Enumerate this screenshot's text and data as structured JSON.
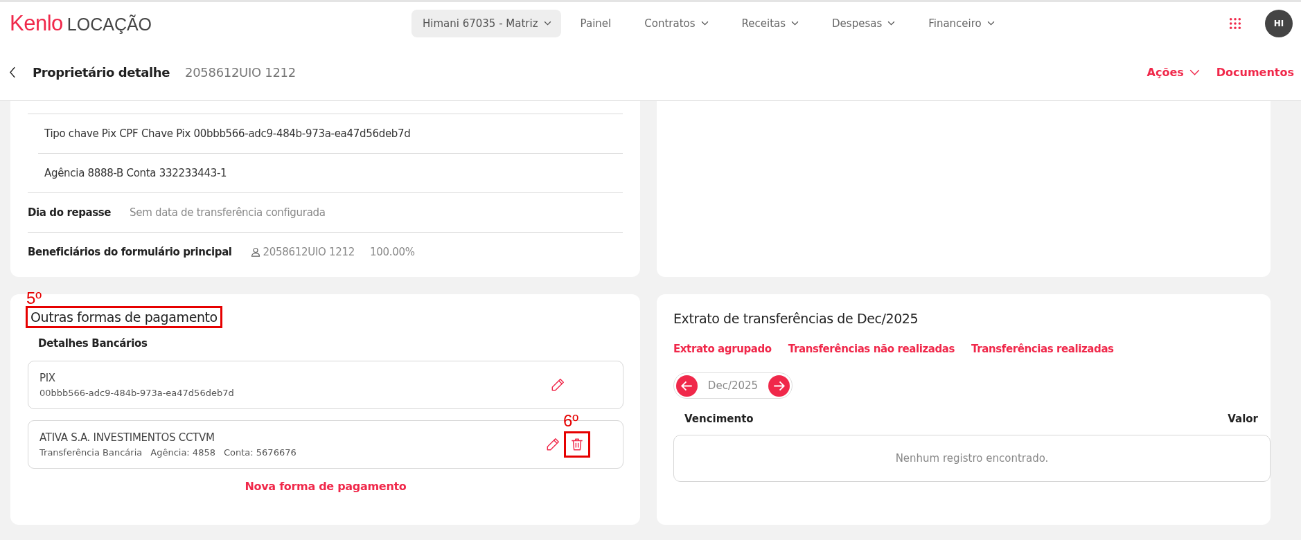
{
  "app": {
    "logo_brand": "Kenlo",
    "logo_product": "LOCAÇÃO"
  },
  "nav": {
    "branch": "Himani 67035 - Matriz",
    "items": [
      {
        "label": "Painel",
        "dropdown": false
      },
      {
        "label": "Contratos",
        "dropdown": true
      },
      {
        "label": "Receitas",
        "dropdown": true
      },
      {
        "label": "Despesas",
        "dropdown": true
      },
      {
        "label": "Financeiro",
        "dropdown": true
      }
    ],
    "avatar": "HI"
  },
  "page": {
    "title": "Proprietário detalhe",
    "code": "2058612UIO 1212",
    "actions": [
      {
        "label": "Ações",
        "dropdown": true
      },
      {
        "label": "Documentos",
        "dropdown": false
      }
    ]
  },
  "owner_details": {
    "bank_rows": [
      "Tipo chave Pix CPF Chave Pix 00bbb566-adc9-484b-973a-ea47d56deb7d",
      "Agência 8888-B Conta 332233443-1"
    ],
    "fields": [
      {
        "label": "Dia do repasse",
        "kind": "text",
        "value": "Sem data de transferência configurada"
      },
      {
        "label": "Beneficiários do formulário principal",
        "kind": "beneficiary",
        "value": "2058612UIO 1212",
        "share": "100.00%"
      }
    ]
  },
  "payment_methods": {
    "title": "Outras formas de pagamento",
    "marker": "5º",
    "subtitle": "Detalhes Bancários",
    "items": [
      {
        "name": "PIX",
        "details": [
          "00bbb566-adc9-484b-973a-ea47d56deb7d"
        ],
        "deletable": false
      },
      {
        "name": "ATIVA S.A. INVESTIMENTOS CCTVM",
        "details": [
          "Transferência Bancária",
          "Agência: 4858",
          "Conta: 5676676"
        ],
        "deletable": true,
        "marker": "6º"
      }
    ],
    "add_link": "Nova forma de pagamento"
  },
  "statement": {
    "title": "Extrato de transferências de Dec/2025",
    "tabs": [
      "Extrato agrupado",
      "Transferências não realizadas",
      "Transferências realizadas"
    ],
    "month": "Dec/2025",
    "columns": [
      "Vencimento",
      "Valor"
    ],
    "empty_message": "Nenhum registro encontrado."
  }
}
